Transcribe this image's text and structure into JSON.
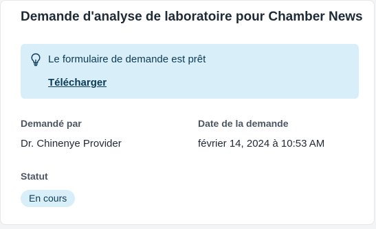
{
  "card": {
    "title": "Demande d'analyse de laboratoire pour Chamber News"
  },
  "banner": {
    "icon": "lightbulb-icon",
    "message": "Le formulaire de demande est prêt",
    "link_label": "Télécharger",
    "background_color": "#d8eef8"
  },
  "details": {
    "requested_by_label": "Demandé par",
    "requested_by_value": "Dr. Chinenye Provider",
    "request_date_label": "Date de la demande",
    "request_date_value": "février 14, 2024 à 10:53 AM",
    "status_label": "Statut",
    "status_value": "En cours"
  }
}
